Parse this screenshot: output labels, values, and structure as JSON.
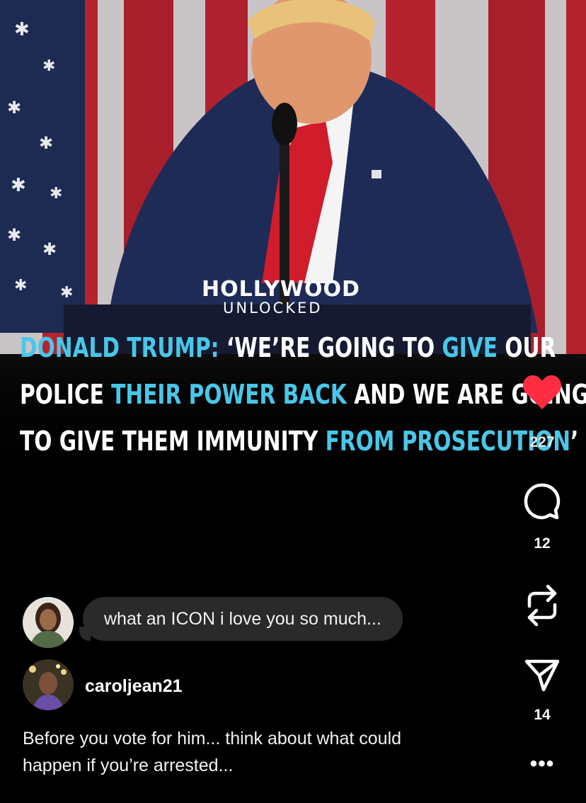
{
  "video": {
    "brand_top": "HOLLYWOOD",
    "brand_bottom": "NLOCKED",
    "brand_bottom_first": "U",
    "headline": {
      "line1_a": "DONALD TRUMP:",
      "line1_b": " ‘WE’RE GOING TO ",
      "line1_c": "GIVE",
      "line1_d": " OUR",
      "line2_a": "POLICE ",
      "line2_b": "THEIR POWER BACK",
      "line2_c": " AND WE ARE GOING",
      "line3_a": "TO GIVE THEM IMMUNITY ",
      "line3_b": "FROM PROSECUTION",
      "line3_c": "’"
    },
    "accent_color": "#49c7e8"
  },
  "actions": {
    "like_count": "227",
    "comment_count": "12",
    "share_count": "14",
    "like_color": "#ff2d42",
    "more_label": "•••"
  },
  "top_comment": {
    "text": "what an ICON i love you so much..."
  },
  "post": {
    "author": "caroljean21",
    "caption_line1": "Before you vote for him... think about what could",
    "caption_line2": "happen if you’re arrested..."
  }
}
